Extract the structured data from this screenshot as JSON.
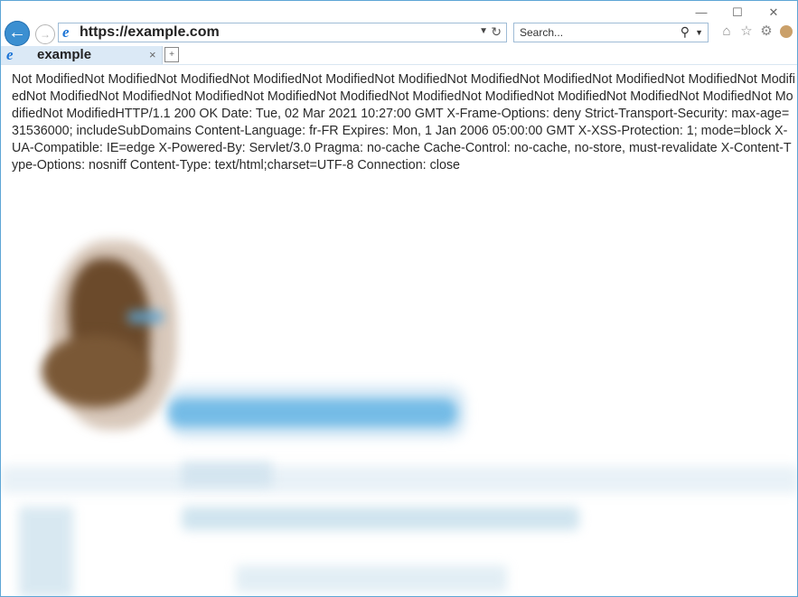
{
  "window": {
    "minimize": "—",
    "maximize": "☐",
    "close": "✕"
  },
  "nav": {
    "back": "←",
    "forward": "→",
    "url": "https://example.com",
    "search_placeholder": "Search...",
    "icons": [
      "back-icon",
      "forward-icon",
      "ie-logo-icon",
      "dropdown-icon",
      "refresh-icon",
      "search-icon",
      "home-icon",
      "star-icon",
      "gear-icon",
      "smiley-icon"
    ]
  },
  "tab": {
    "title": "example",
    "close": "×"
  },
  "content": {
    "body_text": "Not ModifiedNot ModifiedNot ModifiedNot ModifiedNot ModifiedNot ModifiedNot ModifiedNot ModifiedNot ModifiedNot ModifiedNot ModifiedNot ModifiedNot ModifiedNot ModifiedNot ModifiedNot ModifiedNot ModifiedNot ModifiedNot ModifiedNot ModifiedNot ModifiedNot ModifiedNot ModifiedHTTP/1.1 200 OK Date: Tue, 02 Mar 2021 10:27:00 GMT X-Frame-Options: deny Strict-Transport-Security: max-age=31536000; includeSubDomains Content-Language: fr-FR Expires: Mon, 1 Jan 2006 05:00:00 GMT X-XSS-Protection: 1; mode=block X-UA-Compatible: IE=edge X-Powered-By: Servlet/3.0 Pragma: no-cache Cache-Control: no-cache, no-store, must-revalidate X-Content-Type-Options: nosniff Content-Type: text/html;charset=UTF-8 Connection: close"
  },
  "colors": {
    "accent": "#3b8fd1",
    "border": "#5ea6d6",
    "tab_bg": "#dbe9f6"
  }
}
